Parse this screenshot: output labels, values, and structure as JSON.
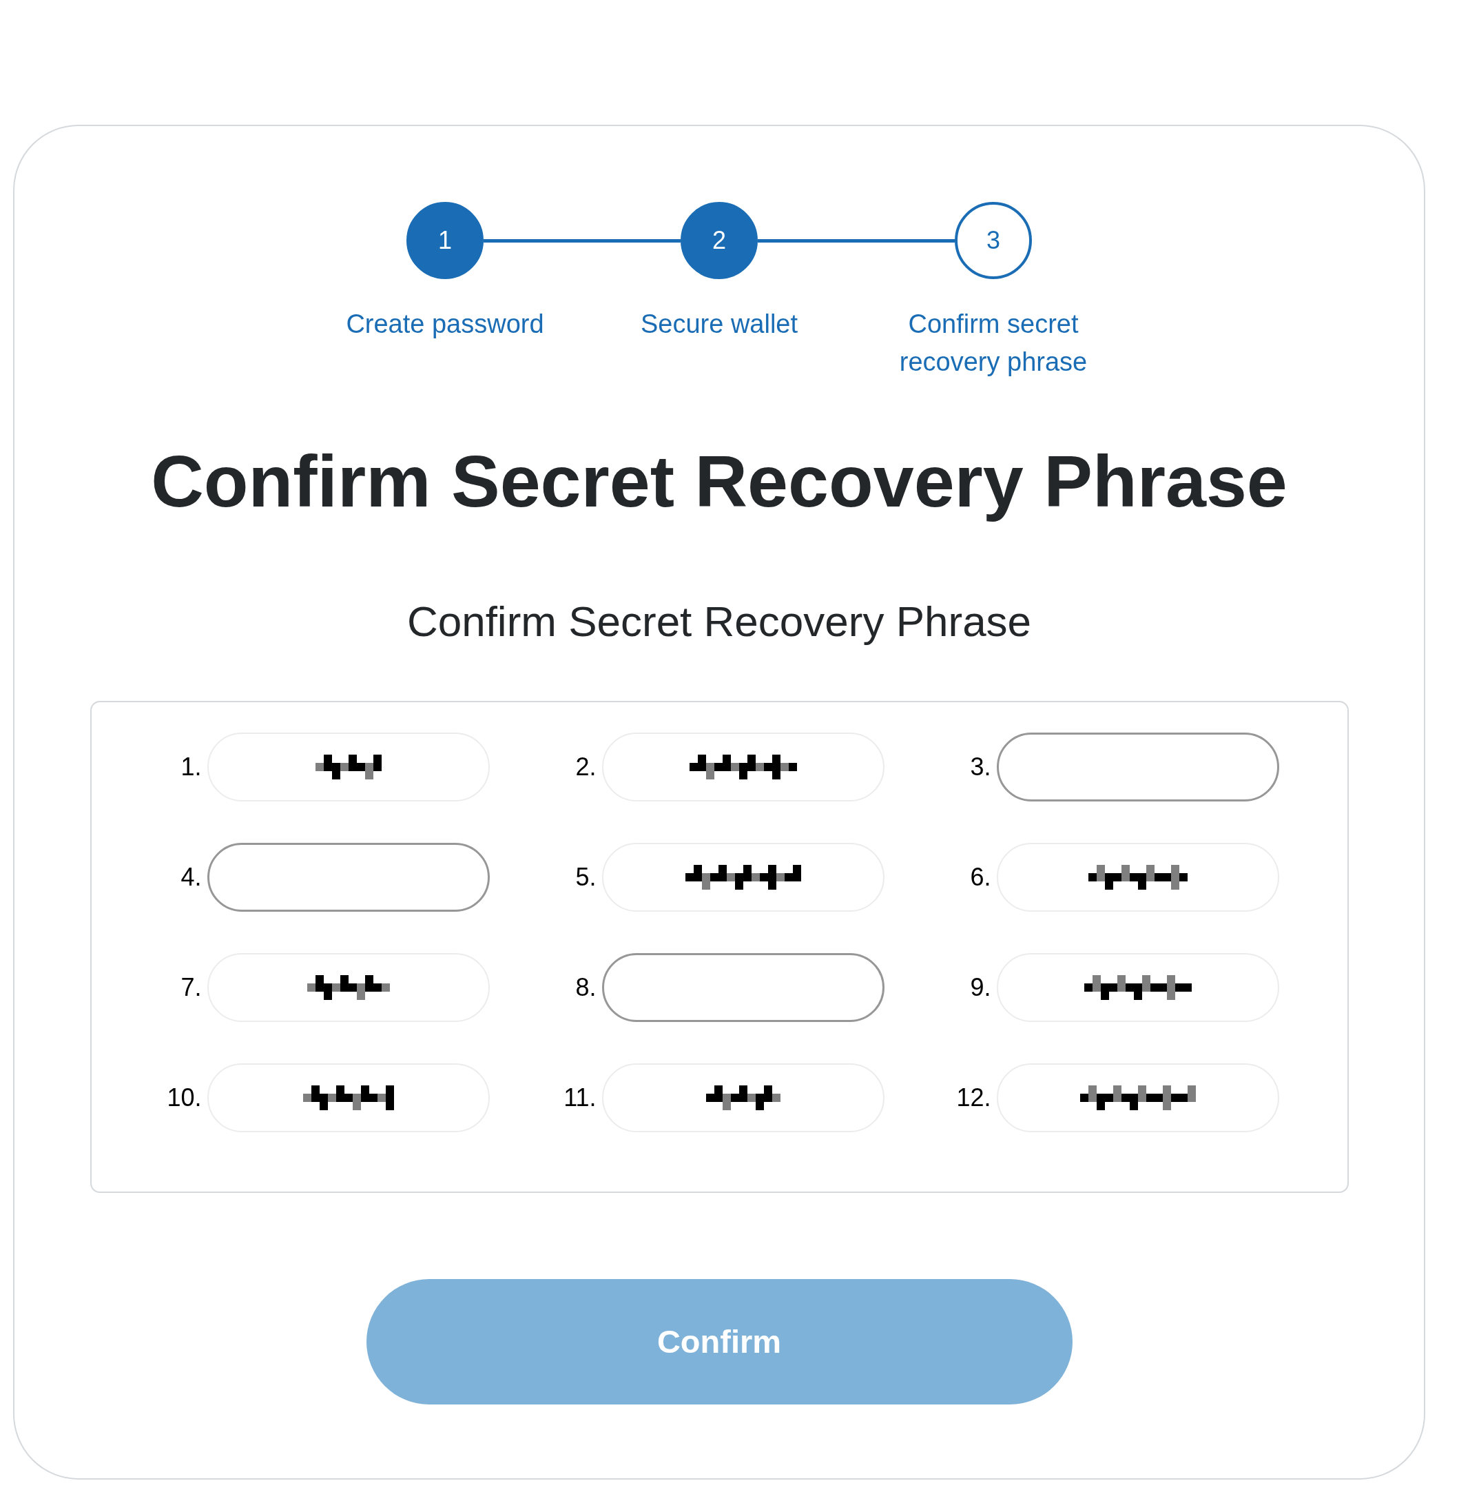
{
  "steps": [
    {
      "number": "1",
      "label": "Create password",
      "completed": true
    },
    {
      "number": "2",
      "label": "Secure wallet",
      "completed": true
    },
    {
      "number": "3",
      "label": "Confirm secret recovery phrase",
      "completed": false
    }
  ],
  "title": "Confirm Secret Recovery Phrase",
  "subtitle": "Confirm Secret Recovery Phrase",
  "phrase_panel": {
    "words": [
      {
        "index": "1.",
        "kind": "hidden"
      },
      {
        "index": "2.",
        "kind": "hidden"
      },
      {
        "index": "3.",
        "kind": "blank"
      },
      {
        "index": "4.",
        "kind": "blank"
      },
      {
        "index": "5.",
        "kind": "hidden"
      },
      {
        "index": "6.",
        "kind": "hidden"
      },
      {
        "index": "7.",
        "kind": "hidden"
      },
      {
        "index": "8.",
        "kind": "blank"
      },
      {
        "index": "9.",
        "kind": "hidden"
      },
      {
        "index": "10.",
        "kind": "hidden"
      },
      {
        "index": "11.",
        "kind": "hidden"
      },
      {
        "index": "12.",
        "kind": "hidden"
      }
    ]
  },
  "confirm_button": {
    "label": "Confirm",
    "disabled": true
  }
}
